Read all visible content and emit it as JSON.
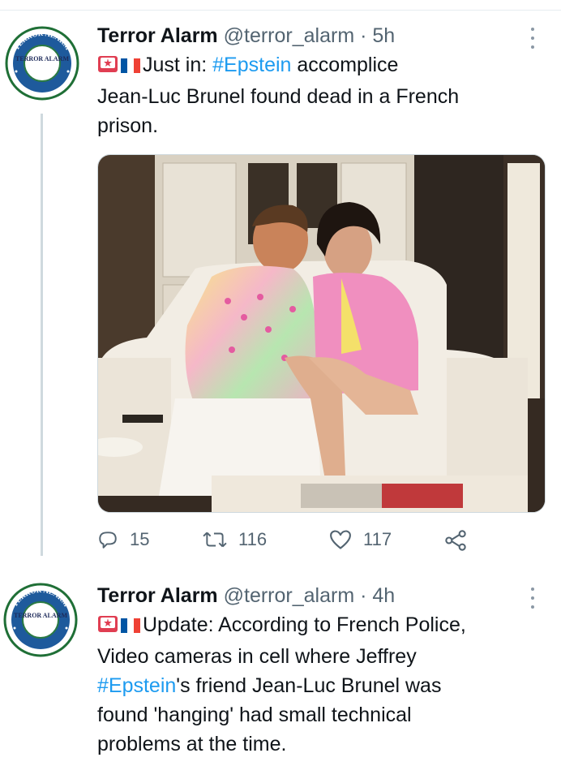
{
  "tweets": [
    {
      "name": "Terror Alarm",
      "handle": "@terror_alarm",
      "separator": "·",
      "time": "5h",
      "text_prefix": "Just in: ",
      "hashtag": "#Epstein",
      "text_line1_rest": " accomplice",
      "text_line2": "Jean-Luc Brunel found dead in a French",
      "text_line3": "prison.",
      "reply_count": "15",
      "retweet_count": "116",
      "like_count": "117",
      "avatar_text_top": "TERROR ALARM",
      "avatar_text_center": "TERROR ALARM"
    },
    {
      "name": "Terror Alarm",
      "handle": "@terror_alarm",
      "separator": "·",
      "time": "4h",
      "line1": "Update: According to French Police,",
      "line2": "Video cameras in cell where Jeffrey",
      "hashtag": "#Epstein",
      "line3_rest": "'s friend Jean-Luc Brunel was",
      "line4": "found 'hanging' had small technical",
      "line5": "problems at the time.",
      "avatar_text_top": "TERROR ALARM",
      "avatar_text_center": "TERROR ALARM"
    }
  ],
  "colors": {
    "link": "#1d9bf0",
    "secondary_text": "#536471",
    "thread_line": "#cfd9de",
    "avatar_ring": "#1d7a3a"
  },
  "icons": [
    "police-light-icon",
    "french-flag-icon",
    "reply-icon",
    "retweet-icon",
    "like-icon",
    "share-icon",
    "more-icon"
  ]
}
